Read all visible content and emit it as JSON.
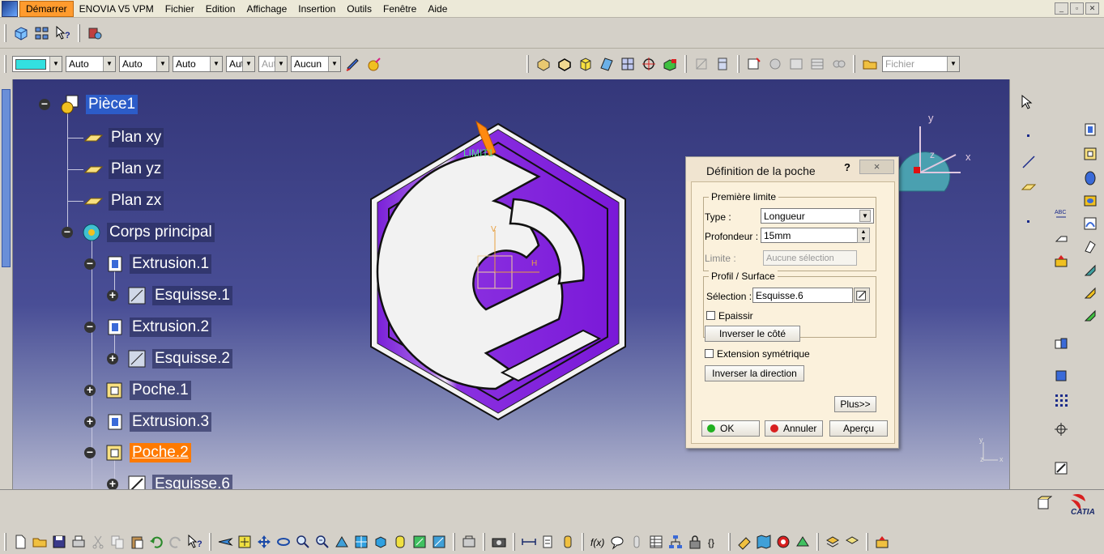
{
  "menu": {
    "items": [
      "Démarrer",
      "ENOVIA V5 VPM",
      "Fichier",
      "Edition",
      "Affichage",
      "Insertion",
      "Outils",
      "Fenêtre",
      "Aide"
    ]
  },
  "toolbar": {
    "color_swatch": "#33e0e0",
    "combos": [
      {
        "value": "Auto",
        "w": 62
      },
      {
        "value": "Auto",
        "w": 62
      },
      {
        "value": "Auto",
        "w": 62
      },
      {
        "value": "Aut",
        "w": 36
      },
      {
        "value": "Aut",
        "w": 36,
        "disabled": true
      },
      {
        "value": "Aucun",
        "w": 62
      }
    ],
    "fichier_combo": "Fichier"
  },
  "tree": {
    "nodes": {
      "piece": "Pièce1",
      "plan_xy": "Plan xy",
      "plan_yz": "Plan yz",
      "plan_zx": "Plan zx",
      "corps": "Corps principal",
      "extrusion1": "Extrusion.1",
      "esquisse1": "Esquisse.1",
      "extrusion2": "Extrusion.2",
      "esquisse2": "Esquisse.2",
      "poche1": "Poche.1",
      "extrusion3": "Extrusion.3",
      "poche2": "Poche.2",
      "esquisse6": "Esquisse.6"
    }
  },
  "viewport": {
    "limit_label": "LIMIT1",
    "axis_v": "V",
    "axis_h": "H",
    "compass_y": "y",
    "compass_z": "z",
    "compass_x": "x",
    "mini_y": "y",
    "mini_x": "x",
    "mini_z": "z",
    "part_color": "#8a2be2"
  },
  "dialog": {
    "title": "Définition de la poche",
    "help": "?",
    "close": "×",
    "group1_title": "Première limite",
    "type_label": "Type :",
    "type_value": "Longueur",
    "profondeur_label": "Profondeur :",
    "profondeur_value": "15mm",
    "limite_label": "Limite :",
    "limite_value": "Aucune sélection",
    "group2_title": "Profil / Surface",
    "selection_label": "Sélection :",
    "selection_value": "Esquisse.6",
    "epaissir_label": "Epaissir",
    "inverser_cote": "Inverser le côté",
    "extension_label": "Extension symétrique",
    "inverser_direction": "Inverser la direction",
    "plus": "Plus>>",
    "ok": "OK",
    "annuler": "Annuler",
    "apercu": "Aperçu"
  },
  "brand": "CATIA"
}
